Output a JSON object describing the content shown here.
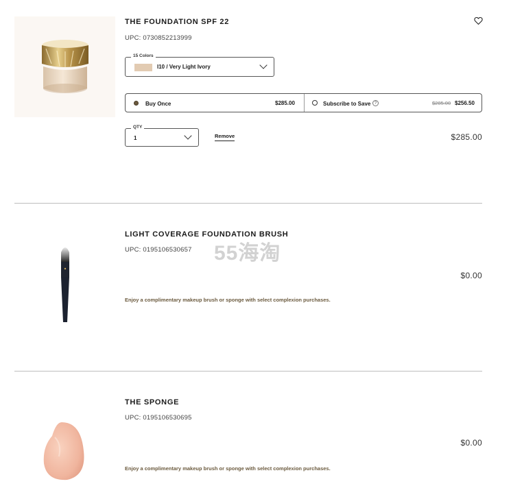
{
  "items": [
    {
      "title": "THE FOUNDATION SPF 22",
      "upc": "UPC: 0730852213999",
      "color_legend": "15 Colors",
      "color_selected": "I10 / Very Light Ivory",
      "swatch_color": "#e2cbb2",
      "buy_once_label": "Buy Once",
      "buy_once_price": "$285.00",
      "subscribe_label": "Subscribe to Save",
      "subscribe_old_price": "$285.00",
      "subscribe_new_price": "$256.50",
      "qty_legend": "QTY",
      "qty_value": "1",
      "remove_label": "Remove",
      "price": "$285.00",
      "wishlist_icon": "heart-icon"
    },
    {
      "title": "LIGHT COVERAGE FOUNDATION BRUSH",
      "upc": "UPC: 0195106530657",
      "price": "$0.00",
      "promo": "Enjoy a complimentary makeup brush or sponge with select complexion purchases."
    },
    {
      "title": "THE SPONGE",
      "upc": "UPC: 0195106530695",
      "price": "$0.00",
      "promo": "Enjoy a complimentary makeup brush or sponge with select complexion purchases."
    }
  ],
  "watermark": "55海淘",
  "colors": {
    "accent": "#6b5a3e",
    "divider": "#bdbdbd"
  }
}
